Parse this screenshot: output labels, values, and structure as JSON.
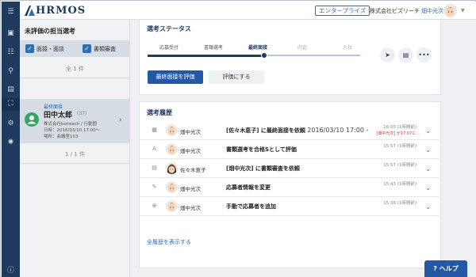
{
  "header": {
    "logo_text": "HRMOS",
    "plan_badge": "エンタープライズ",
    "company": "株式会社ビズリーチ",
    "user_name": "畑中光次"
  },
  "rail": {
    "icons": [
      "menu-icon",
      "dashboard-icon",
      "list-icon",
      "search-icon",
      "document-icon",
      "candidate-icon",
      "settings-icon",
      "gear-icon",
      "info-icon"
    ]
  },
  "left_panel": {
    "title": "未評価の担当選考",
    "filters": [
      {
        "label": "面接・面談",
        "checked": true
      },
      {
        "label": "書類審査",
        "checked": true
      }
    ],
    "count_top": "全 1 件",
    "candidate": {
      "stage": "最終面接",
      "name": "田中太郎",
      "age": "(37)",
      "company": "株式会社bizreach / 行動囲",
      "datetime": "日時：2016/03/10 17:00〜",
      "place": "場所：会議室103"
    },
    "pagination": "1 / 1 件"
  },
  "status": {
    "title": "選考ステータス",
    "steps": [
      {
        "label": "応募受付",
        "state": "done"
      },
      {
        "label": "書類選考",
        "state": "done"
      },
      {
        "label": "最終面接",
        "state": "current"
      },
      {
        "label": "内定",
        "state": "future"
      },
      {
        "label": "入社",
        "state": "future"
      }
    ],
    "progress": 0.55,
    "primary_button": "最終面接を評価",
    "secondary_button": "評価にする"
  },
  "history": {
    "title": "選考履歴",
    "rows": [
      {
        "icon": "calendar-icon",
        "icon_glyph": "▦",
        "avatar": "male",
        "actor": "畑中光次",
        "text": "[佐々木恵子] に最終面接を依頼",
        "date": "2016/03/10 17:00 -",
        "time": "16:00 (1時間前)",
        "sub": "[畑中光次] が17:07に..."
      },
      {
        "icon": "grade-icon",
        "icon_glyph": "A",
        "avatar": "male",
        "actor": "畑中光次",
        "text": "書類選考を合格Sとして評価",
        "date": "",
        "time": "15:57 (1時間前)",
        "sub": ""
      },
      {
        "icon": "document-review-icon",
        "icon_glyph": "▤",
        "avatar": "female",
        "actor": "佐々木恵子",
        "text": "[畑中光次] に書類審査を依頼",
        "date": "",
        "time": "15:57 (1時間前)",
        "sub": ""
      },
      {
        "icon": "pencil-icon",
        "icon_glyph": "✎",
        "avatar": "male",
        "actor": "畑中光次",
        "text": "応募者情報を変更",
        "date": "",
        "time": "15:43 (1時間前)",
        "sub": ""
      },
      {
        "icon": "plus-circle-icon",
        "icon_glyph": "⊕",
        "avatar": "male",
        "actor": "畑中光次",
        "text": "手動で応募者を追加",
        "date": "",
        "time": "15:38 (1時間前)",
        "sub": ""
      }
    ],
    "show_all_link": "全履歴を表示する"
  },
  "help": {
    "label": "ヘルプ"
  },
  "colors": {
    "navy": "#1f3a5c",
    "accent": "#2458a4",
    "link": "#2d6fb5"
  }
}
